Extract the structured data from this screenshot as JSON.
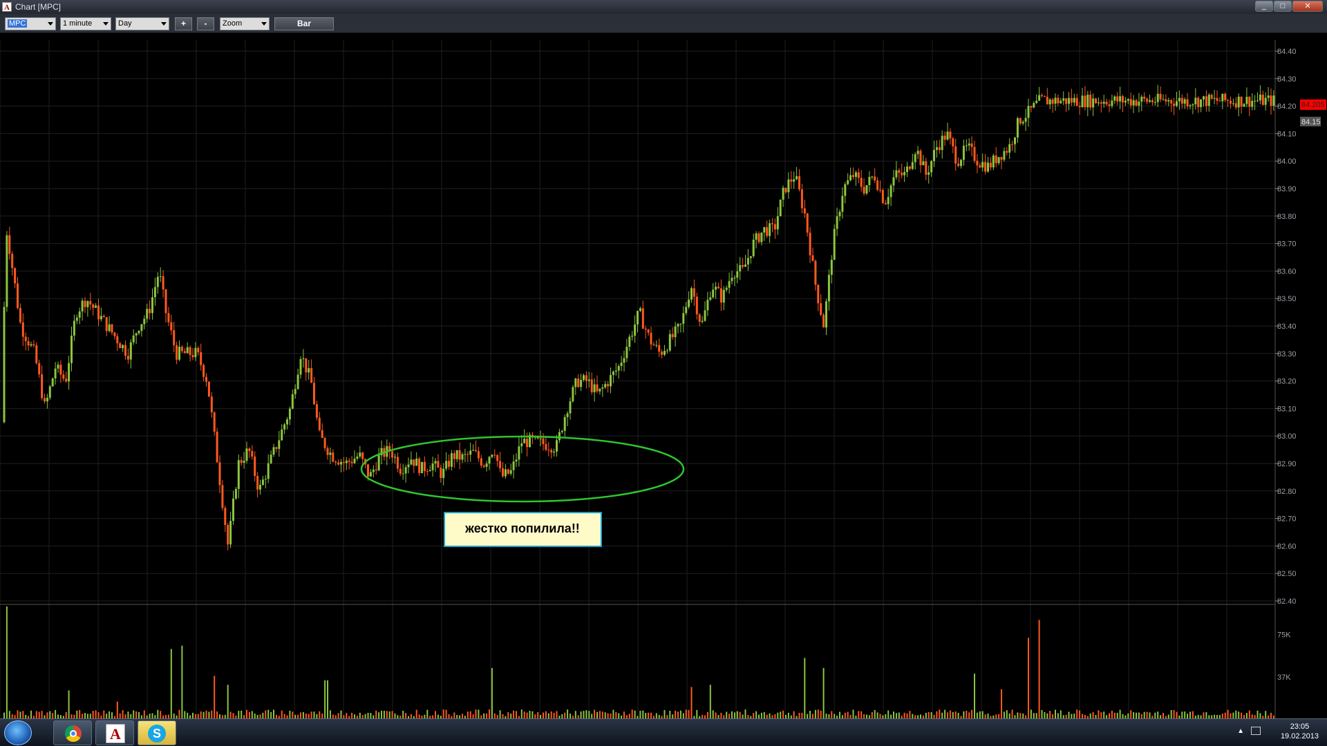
{
  "window": {
    "title": "Chart [MPC]",
    "controls": [
      "_",
      "□",
      "✕"
    ]
  },
  "toolbar": {
    "symbol": "MPC",
    "interval": "1 minute",
    "range": "Day",
    "plus_label": "+",
    "minus_label": "-",
    "zoom": "Zoom",
    "bar_label": "Bar"
  },
  "price_axis": {
    "ticks": [
      "84.40",
      "84.30",
      "84.20",
      "84.10",
      "84.00",
      "83.90",
      "83.80",
      "83.70",
      "83.60",
      "83.50",
      "83.40",
      "83.30",
      "83.20",
      "83.10",
      "83.00",
      "82.90",
      "82.80",
      "82.70",
      "82.60",
      "82.50",
      "82.40"
    ],
    "last_price": "84.205",
    "prev_price": "84.15"
  },
  "volume_axis": {
    "ticks": [
      "75K",
      "37K"
    ]
  },
  "annotation": {
    "text": "жестко попилила!!",
    "ellipse_color": "#2fc52f"
  },
  "colors": {
    "up": "#8cc63f",
    "down": "#ff5a1e",
    "last_price_bg": "#ff0000",
    "grid": "#1f1f1f"
  },
  "chart_data": {
    "type": "candlestick",
    "ylim": [
      82.4,
      84.4
    ],
    "volume_ylim": [
      0,
      100000
    ],
    "path": [
      [
        0,
        83.05
      ],
      [
        10,
        83.75
      ],
      [
        30,
        83.4
      ],
      [
        50,
        83.3
      ],
      [
        65,
        83.1
      ],
      [
        80,
        83.25
      ],
      [
        95,
        83.2
      ],
      [
        110,
        83.45
      ],
      [
        125,
        83.5
      ],
      [
        140,
        83.45
      ],
      [
        155,
        83.4
      ],
      [
        170,
        83.35
      ],
      [
        185,
        83.3
      ],
      [
        200,
        83.4
      ],
      [
        215,
        83.45
      ],
      [
        230,
        83.6
      ],
      [
        240,
        83.45
      ],
      [
        255,
        83.3
      ],
      [
        270,
        83.3
      ],
      [
        285,
        83.3
      ],
      [
        300,
        83.2
      ],
      [
        315,
        82.9
      ],
      [
        330,
        82.6
      ],
      [
        345,
        82.9
      ],
      [
        360,
        82.95
      ],
      [
        375,
        82.8
      ],
      [
        390,
        82.9
      ],
      [
        405,
        83.0
      ],
      [
        420,
        83.1
      ],
      [
        435,
        83.3
      ],
      [
        450,
        83.2
      ],
      [
        462,
        83.0
      ],
      [
        480,
        82.93
      ],
      [
        500,
        82.9
      ],
      [
        520,
        82.93
      ],
      [
        535,
        82.85
      ],
      [
        550,
        82.93
      ],
      [
        565,
        82.95
      ],
      [
        580,
        82.88
      ],
      [
        595,
        82.92
      ],
      [
        610,
        82.88
      ],
      [
        625,
        82.9
      ],
      [
        640,
        82.86
      ],
      [
        655,
        82.93
      ],
      [
        670,
        82.92
      ],
      [
        685,
        82.94
      ],
      [
        700,
        82.9
      ],
      [
        715,
        82.96
      ],
      [
        725,
        82.85
      ],
      [
        740,
        82.87
      ],
      [
        755,
        82.98
      ],
      [
        770,
        82.98
      ],
      [
        790,
        82.97
      ],
      [
        805,
        82.96
      ],
      [
        820,
        83.1
      ],
      [
        835,
        83.2
      ],
      [
        850,
        83.2
      ],
      [
        865,
        83.15
      ],
      [
        880,
        83.2
      ],
      [
        895,
        83.25
      ],
      [
        910,
        83.35
      ],
      [
        925,
        83.45
      ],
      [
        940,
        83.35
      ],
      [
        955,
        83.3
      ],
      [
        970,
        83.35
      ],
      [
        985,
        83.4
      ],
      [
        1000,
        83.55
      ],
      [
        1015,
        83.4
      ],
      [
        1030,
        83.55
      ],
      [
        1045,
        83.5
      ],
      [
        1060,
        83.6
      ],
      [
        1075,
        83.6
      ],
      [
        1090,
        83.7
      ],
      [
        1105,
        83.75
      ],
      [
        1120,
        83.75
      ],
      [
        1135,
        83.9
      ],
      [
        1150,
        83.95
      ],
      [
        1165,
        83.8
      ],
      [
        1180,
        83.55
      ],
      [
        1192,
        83.4
      ],
      [
        1205,
        83.7
      ],
      [
        1220,
        83.9
      ],
      [
        1235,
        83.95
      ],
      [
        1250,
        83.9
      ],
      [
        1265,
        83.95
      ],
      [
        1280,
        83.85
      ],
      [
        1295,
        83.95
      ],
      [
        1310,
        83.95
      ],
      [
        1325,
        84.05
      ],
      [
        1340,
        83.95
      ],
      [
        1355,
        84.05
      ],
      [
        1370,
        84.1
      ],
      [
        1385,
        84.0
      ],
      [
        1400,
        84.05
      ],
      [
        1415,
        84.0
      ],
      [
        1430,
        83.98
      ],
      [
        1445,
        84.02
      ],
      [
        1460,
        84.05
      ],
      [
        1475,
        84.15
      ],
      [
        1490,
        84.18
      ],
      [
        1505,
        84.22
      ]
    ],
    "volume_spikes": [
      [
        11,
        100000
      ],
      [
        100,
        25000
      ],
      [
        170,
        15000
      ],
      [
        247,
        62000
      ],
      [
        262,
        65000
      ],
      [
        312,
        38000
      ],
      [
        330,
        30000
      ],
      [
        472,
        34000
      ],
      [
        711,
        45000
      ],
      [
        1000,
        28000
      ],
      [
        1028,
        30000
      ],
      [
        1163,
        54000
      ],
      [
        1191,
        45000
      ],
      [
        1410,
        40000
      ],
      [
        1448,
        26000
      ],
      [
        1487,
        72000
      ],
      [
        1502,
        88000
      ]
    ]
  },
  "taskbar": {
    "clock_time": "23:05",
    "clock_date": "19.02.2013",
    "app_letter": "A",
    "skype_letter": "S",
    "tray_arrow": "▲"
  }
}
